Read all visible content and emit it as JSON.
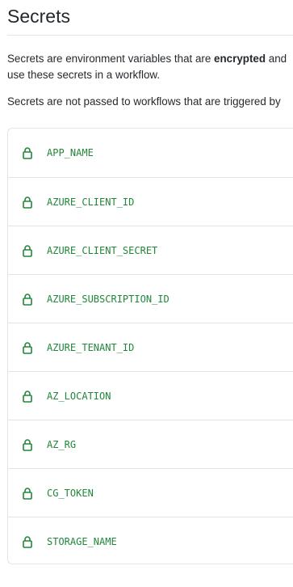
{
  "page": {
    "title": "Secrets",
    "description_line1_before": "Secrets are environment variables that are ",
    "description_line1_bold": "encrypted",
    "description_line1_after": " and",
    "description_line2": "use these secrets in a workflow.",
    "description_line3": "Secrets are not passed to workflows that are triggered by"
  },
  "colors": {
    "secret_name": "#22863a",
    "lock_icon": "#22863a",
    "border": "#e1e4e8",
    "text": "#24292e"
  },
  "secrets": [
    {
      "name": "APP_NAME",
      "icon": "lock-icon"
    },
    {
      "name": "AZURE_CLIENT_ID",
      "icon": "lock-icon"
    },
    {
      "name": "AZURE_CLIENT_SECRET",
      "icon": "lock-icon"
    },
    {
      "name": "AZURE_SUBSCRIPTION_ID",
      "icon": "lock-icon"
    },
    {
      "name": "AZURE_TENANT_ID",
      "icon": "lock-icon"
    },
    {
      "name": "AZ_LOCATION",
      "icon": "lock-icon"
    },
    {
      "name": "AZ_RG",
      "icon": "lock-icon"
    },
    {
      "name": "CG_TOKEN",
      "icon": "lock-icon"
    },
    {
      "name": "STORAGE_NAME",
      "icon": "lock-icon"
    }
  ]
}
